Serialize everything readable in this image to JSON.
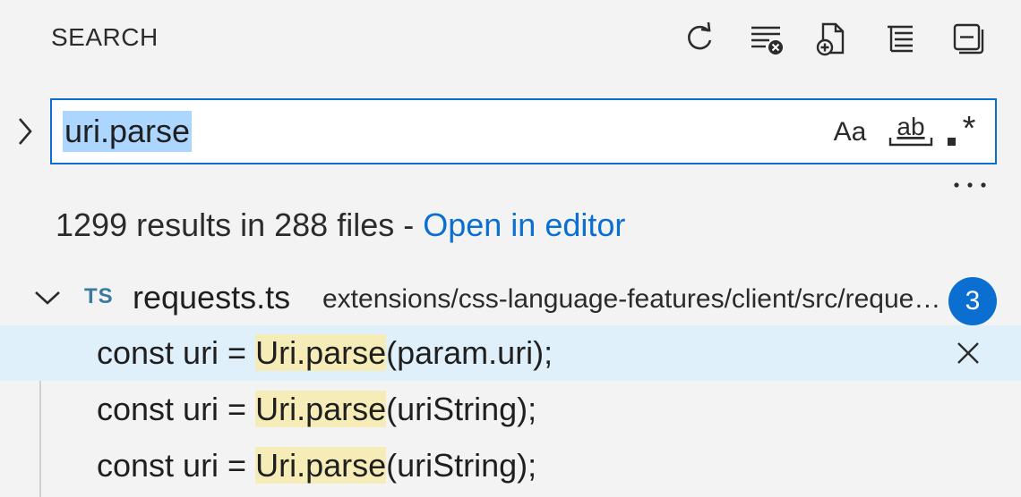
{
  "header": {
    "title": "SEARCH"
  },
  "toolbar": {
    "icons": [
      "refresh-icon",
      "clear-results-icon",
      "new-search-editor-icon",
      "view-as-tree-icon",
      "collapse-all-icon"
    ]
  },
  "search": {
    "query": "uri.parse",
    "options": {
      "match_case": "Aa",
      "whole_word": "ab",
      "regex": ".*"
    }
  },
  "summary": {
    "text": "1299 results in 288 files - ",
    "link": "Open in editor"
  },
  "file": {
    "icon_label": "TS",
    "name": "requests.ts",
    "path": "extensions/css-language-features/client/src/requests.ts",
    "count": "3"
  },
  "results": [
    {
      "before": "const uri = ",
      "match": "Uri.parse",
      "after": "(param.uri);",
      "selected": true
    },
    {
      "before": "const uri = ",
      "match": "Uri.parse",
      "after": "(uriString);",
      "selected": false
    },
    {
      "before": "const uri = ",
      "match": "Uri.parse",
      "after": "(uriString);",
      "selected": false
    }
  ],
  "colors": {
    "accent": "#0a6fd1",
    "selection_highlight": "#add6ff",
    "match_highlight": "#f6ecb7",
    "selected_row": "#e0f0fb"
  }
}
